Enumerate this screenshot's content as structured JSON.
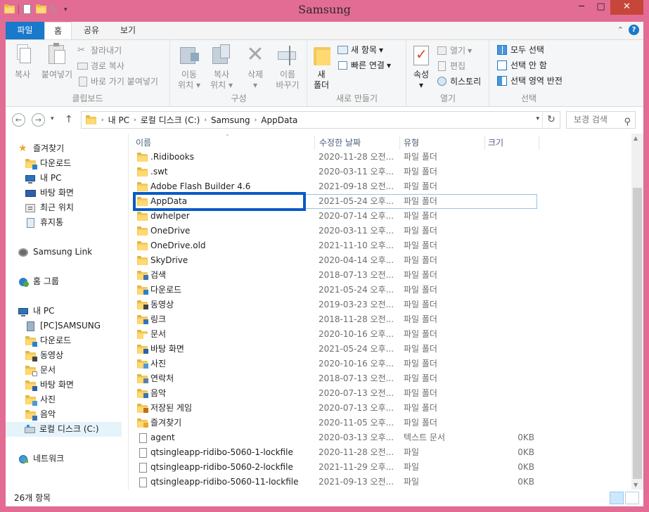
{
  "window": {
    "title": "Samsung",
    "minimize": "─",
    "maximize": "□",
    "close": "✕"
  },
  "ribbon_tabs": {
    "file": "파일",
    "home": "홈",
    "share": "공유",
    "view": "보기",
    "collapse": "⌃",
    "help": "?"
  },
  "ribbon": {
    "clipboard": {
      "label": "클립보드",
      "copy": "복사",
      "paste": "붙여넣기",
      "cut": "잘라내기",
      "copy_path": "경로 복사",
      "paste_shortcut": "바로 가기 붙여넣기"
    },
    "organize": {
      "label": "구성",
      "move_to_1": "이동",
      "move_to_2": "위치",
      "copy_to_1": "복사",
      "copy_to_2": "위치",
      "delete": "삭제",
      "rename_1": "이름",
      "rename_2": "바꾸기"
    },
    "new": {
      "label": "새로 만들기",
      "new_folder_1": "새",
      "new_folder_2": "폴더",
      "new_item": "새 항목",
      "easy_access": "빠른 연결"
    },
    "open": {
      "label": "열기",
      "properties": "속성",
      "open": "열기",
      "edit": "편집",
      "history": "히스토리"
    },
    "select": {
      "label": "선택",
      "select_all": "모두 선택",
      "select_none": "선택 안 함",
      "invert": "선택 영역 반전"
    }
  },
  "address": {
    "segments": [
      "내 PC",
      "로컬 디스크 (C:)",
      "Samsung",
      "AppData"
    ],
    "search_placeholder": "보경 검색"
  },
  "navpane": [
    {
      "label": "즐겨찾기",
      "icon": "star-icon"
    },
    {
      "label": "다운로드",
      "icon": "downloads-folder-icon"
    },
    {
      "label": "내 PC",
      "icon": "pc-icon"
    },
    {
      "label": "바탕 화면",
      "icon": "desktop-icon"
    },
    {
      "label": "최근 위치",
      "icon": "recent-places-icon"
    },
    {
      "label": "휴지통",
      "icon": "recycle-bin-icon"
    },
    {
      "label": "Samsung Link",
      "icon": "samsung-link-icon"
    },
    {
      "label": "홈 그룹",
      "icon": "homegroup-icon"
    },
    {
      "label": "내 PC",
      "icon": "pc-icon"
    },
    {
      "label": "[PC]SAMSUNG",
      "icon": "system-folder-icon"
    },
    {
      "label": "다운로드",
      "icon": "downloads-folder-icon"
    },
    {
      "label": "동영상",
      "icon": "videos-folder-icon"
    },
    {
      "label": "문서",
      "icon": "documents-folder-icon"
    },
    {
      "label": "바탕 화면",
      "icon": "desktop-folder-icon"
    },
    {
      "label": "사진",
      "icon": "pictures-folder-icon"
    },
    {
      "label": "음악",
      "icon": "music-folder-icon"
    },
    {
      "label": "로컬 디스크 (C:)",
      "icon": "local-disk-icon"
    },
    {
      "label": "네트워크",
      "icon": "network-icon"
    }
  ],
  "columns": {
    "name": "이름",
    "date": "수정한 날짜",
    "type": "유형",
    "size": "크기"
  },
  "files": [
    {
      "name": ".Ridibooks",
      "date": "2020-11-28 오전...",
      "type": "파일 폴더",
      "size": "",
      "icon": "folder-icon"
    },
    {
      "name": ".swt",
      "date": "2020-03-11 오후...",
      "type": "파일 폴더",
      "size": "",
      "icon": "folder-icon"
    },
    {
      "name": "Adobe Flash Builder 4.6",
      "date": "2021-09-18 오전...",
      "type": "파일 폴더",
      "size": "",
      "icon": "folder-icon"
    },
    {
      "name": "AppData",
      "date": "2021-05-24 오후...",
      "type": "파일 폴더",
      "size": "",
      "icon": "folder-icon"
    },
    {
      "name": "dwhelper",
      "date": "2020-07-14 오후...",
      "type": "파일 폴더",
      "size": "",
      "icon": "folder-icon"
    },
    {
      "name": "OneDrive",
      "date": "2020-03-11 오후...",
      "type": "파일 폴더",
      "size": "",
      "icon": "folder-icon"
    },
    {
      "name": "OneDrive.old",
      "date": "2021-11-10 오후...",
      "type": "파일 폴더",
      "size": "",
      "icon": "folder-icon"
    },
    {
      "name": "SkyDrive",
      "date": "2020-04-14 오후...",
      "type": "파일 폴더",
      "size": "",
      "icon": "folder-icon"
    },
    {
      "name": "검색",
      "date": "2018-07-13 오전...",
      "type": "파일 폴더",
      "size": "",
      "icon": "searches-folder-icon"
    },
    {
      "name": "다운로드",
      "date": "2021-05-24 오후...",
      "type": "파일 폴더",
      "size": "",
      "icon": "downloads-folder-icon"
    },
    {
      "name": "동영상",
      "date": "2019-03-23 오전...",
      "type": "파일 폴더",
      "size": "",
      "icon": "videos-folder-icon"
    },
    {
      "name": "링크",
      "date": "2018-11-28 오전...",
      "type": "파일 폴더",
      "size": "",
      "icon": "links-folder-icon"
    },
    {
      "name": "문서",
      "date": "2020-10-16 오후...",
      "type": "파일 폴더",
      "size": "",
      "icon": "documents-folder-icon"
    },
    {
      "name": "바탕 화면",
      "date": "2021-05-24 오후...",
      "type": "파일 폴더",
      "size": "",
      "icon": "desktop-folder-icon"
    },
    {
      "name": "사진",
      "date": "2020-10-16 오후...",
      "type": "파일 폴더",
      "size": "",
      "icon": "pictures-folder-icon"
    },
    {
      "name": "연락처",
      "date": "2018-07-13 오전...",
      "type": "파일 폴더",
      "size": "",
      "icon": "contacts-folder-icon"
    },
    {
      "name": "음악",
      "date": "2020-07-13 오전...",
      "type": "파일 폴더",
      "size": "",
      "icon": "music-folder-icon"
    },
    {
      "name": "저장된 게임",
      "date": "2020-07-13 오후...",
      "type": "파일 폴더",
      "size": "",
      "icon": "saved-games-folder-icon"
    },
    {
      "name": "즐겨찾기",
      "date": "2020-11-05 오후...",
      "type": "파일 폴더",
      "size": "",
      "icon": "favorites-folder-icon"
    },
    {
      "name": "agent",
      "date": "2020-03-13 오후...",
      "type": "텍스트 문서",
      "size": "0KB",
      "icon": "text-file-icon"
    },
    {
      "name": "qtsingleapp-ridibo-5060-1-lockfile",
      "date": "2020-11-28 오전...",
      "type": "파일",
      "size": "0KB",
      "icon": "file-icon"
    },
    {
      "name": "qtsingleapp-ridibo-5060-2-lockfile",
      "date": "2021-11-29 오후...",
      "type": "파일",
      "size": "0KB",
      "icon": "file-icon"
    },
    {
      "name": "qtsingleapp-ridibo-5060-11-lockfile",
      "date": "2021-09-13 오전...",
      "type": "파일",
      "size": "0KB",
      "icon": "file-icon"
    }
  ],
  "status": {
    "count": "26개 항목"
  },
  "colors": {
    "window_frame": "#e36c94",
    "accent": "#1979ca",
    "highlight_box": "#0a5bc4"
  }
}
